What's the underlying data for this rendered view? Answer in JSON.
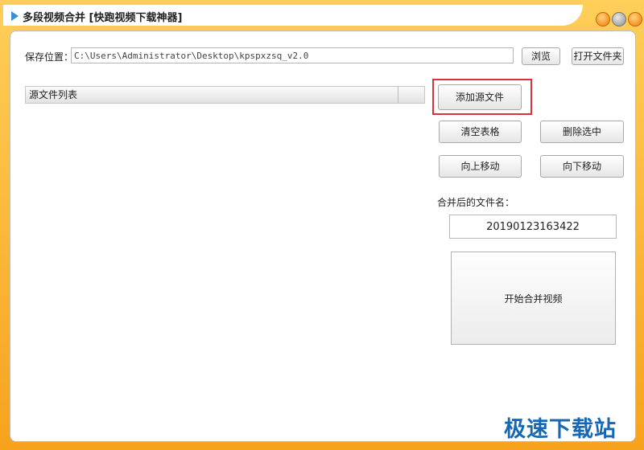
{
  "window": {
    "title": "多段视频合并 [快跑视频下载神器]"
  },
  "save": {
    "label": "保存位置：",
    "path": "C:\\Users\\Administrator\\Desktop\\kpspxzsq_v2.0",
    "browse_label": "浏览",
    "open_folder_label": "打开文件夹"
  },
  "source_list": {
    "columns": [
      "源文件列表",
      ""
    ]
  },
  "actions": {
    "add_source": "添加源文件",
    "clear_table": "清空表格",
    "delete_selected": "删除选中",
    "move_up": "向上移动",
    "move_down": "向下移动"
  },
  "output": {
    "label": "合并后的文件名：",
    "filename": "20190123163422",
    "start_label": "开始合并视频"
  },
  "watermark": "极速下载站",
  "colors": {
    "frame": "#f7a21c",
    "highlight": "#d9323a",
    "watermark": "#1668b4"
  }
}
